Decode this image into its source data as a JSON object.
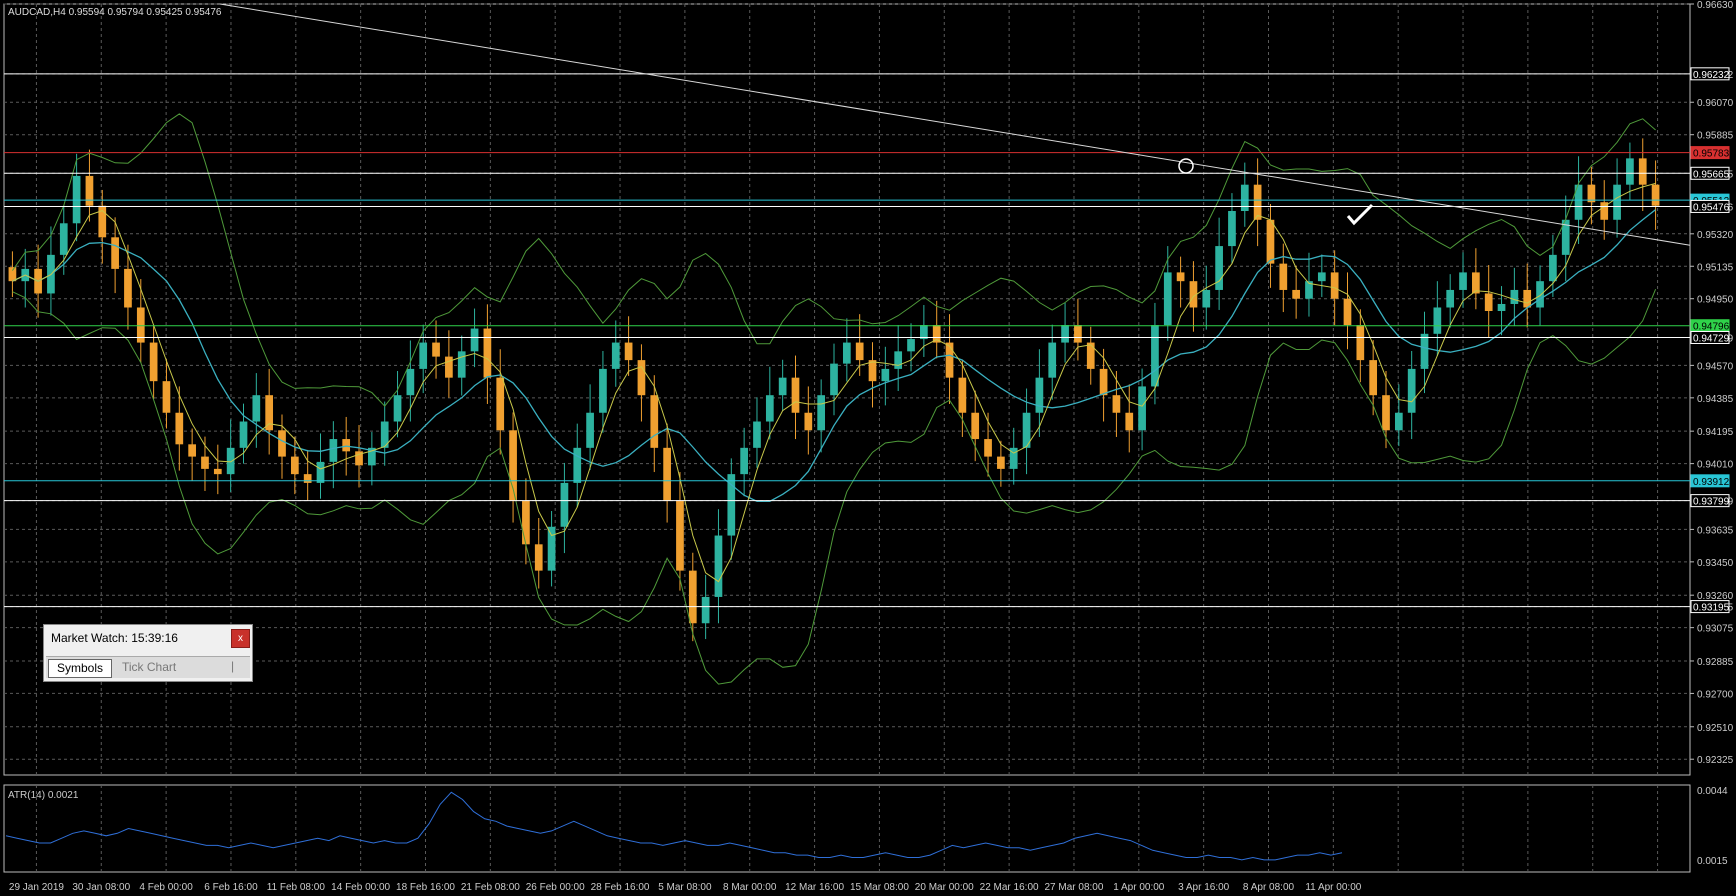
{
  "window": {
    "symbol_line": "AUDCAD,H4  0.95594 0.95794 0.95425 0.95476"
  },
  "colors": {
    "background": "#000000",
    "grid": "#5a5a5a",
    "bull_candle": "#2db3a0",
    "bear_candle": "#f0a030",
    "bollinger": "#4f9a3a",
    "ma_fast": "#c8c84a",
    "ma_slow": "#3ab0c0",
    "atr_line": "#2f6fd8",
    "trendline": "#d8d8d8",
    "support_cyan": "#29c6d6",
    "resistance_red": "#d83030",
    "green_level": "#2fd34a"
  },
  "chart_data": {
    "type": "candlestick",
    "symbol": "AUDCAD",
    "timeframe": "H4",
    "ohlc": {
      "open": 0.95594,
      "high": 0.95794,
      "low": 0.95425,
      "close": 0.95476
    },
    "price_range": [
      0.92235,
      0.9663
    ],
    "price_ticks": [
      "0.96630",
      "0.96232",
      "0.96070",
      "0.95885",
      "0.95665",
      "0.95476",
      "0.95320",
      "0.95135",
      "0.94950",
      "0.94729",
      "0.94570",
      "0.94385",
      "0.94195",
      "0.94010",
      "0.93799",
      "0.93635",
      "0.93450",
      "0.93260",
      "0.93195",
      "0.93075",
      "0.92885",
      "0.92700",
      "0.92510",
      "0.92325"
    ],
    "x_labels": [
      "29 Jan 2019",
      "30 Jan 08:00",
      "4 Feb 00:00",
      "6 Feb 16:00",
      "11 Feb 08:00",
      "14 Feb 00:00",
      "18 Feb 16:00",
      "21 Feb 08:00",
      "26 Feb 00:00",
      "28 Feb 16:00",
      "5 Mar 08:00",
      "8 Mar 00:00",
      "12 Mar 16:00",
      "15 Mar 08:00",
      "20 Mar 00:00",
      "22 Mar 16:00",
      "27 Mar 08:00",
      "1 Apr 00:00",
      "3 Apr 16:00",
      "8 Apr 08:00",
      "11 Apr 00:00"
    ],
    "horizontal_levels": [
      {
        "price": 0.96232,
        "label": "0.96232",
        "color": "#ffffff"
      },
      {
        "price": 0.95783,
        "label": "0.95783",
        "color": "#d83030"
      },
      {
        "price": 0.95665,
        "label": "0.95665",
        "color": "#ffffff"
      },
      {
        "price": 0.95512,
        "label": "0.95512",
        "color": "#29c6d6"
      },
      {
        "price": 0.95476,
        "label": "0.95476",
        "color": "#ffffff"
      },
      {
        "price": 0.94796,
        "label": "0.94796",
        "color": "#2fd34a"
      },
      {
        "price": 0.94729,
        "label": "0.94729",
        "color": "#ffffff"
      },
      {
        "price": 0.93912,
        "label": "0.93912",
        "color": "#29c6d6"
      },
      {
        "price": 0.93799,
        "label": "0.93799",
        "color": "#ffffff"
      },
      {
        "price": 0.93195,
        "label": "0.93195",
        "color": "#ffffff"
      }
    ],
    "close_series": [
      0.9505,
      0.9512,
      0.9498,
      0.952,
      0.9538,
      0.9565,
      0.9548,
      0.953,
      0.9512,
      0.949,
      0.947,
      0.9448,
      0.943,
      0.9412,
      0.9405,
      0.9398,
      0.9395,
      0.941,
      0.9425,
      0.944,
      0.942,
      0.9405,
      0.9395,
      0.939,
      0.9402,
      0.9415,
      0.9408,
      0.94,
      0.941,
      0.9425,
      0.944,
      0.9455,
      0.947,
      0.9462,
      0.945,
      0.9465,
      0.9478,
      0.945,
      0.942,
      0.938,
      0.9355,
      0.934,
      0.9365,
      0.939,
      0.941,
      0.943,
      0.9455,
      0.947,
      0.946,
      0.944,
      0.941,
      0.938,
      0.934,
      0.931,
      0.9325,
      0.936,
      0.9395,
      0.941,
      0.9425,
      0.944,
      0.945,
      0.943,
      0.942,
      0.944,
      0.9458,
      0.947,
      0.946,
      0.9448,
      0.9455,
      0.9465,
      0.9472,
      0.948,
      0.947,
      0.945,
      0.943,
      0.9415,
      0.9405,
      0.9398,
      0.941,
      0.943,
      0.945,
      0.947,
      0.948,
      0.947,
      0.9455,
      0.944,
      0.943,
      0.942,
      0.9445,
      0.948,
      0.951,
      0.9505,
      0.949,
      0.95,
      0.9525,
      0.9545,
      0.956,
      0.954,
      0.9515,
      0.95,
      0.9495,
      0.9505,
      0.951,
      0.9495,
      0.948,
      0.946,
      0.944,
      0.942,
      0.943,
      0.9455,
      0.9475,
      0.949,
      0.95,
      0.951,
      0.9498,
      0.9488,
      0.9492,
      0.95,
      0.949,
      0.9505,
      0.952,
      0.954,
      0.956,
      0.955,
      0.954,
      0.956,
      0.9575,
      0.956,
      0.9548
    ],
    "atr": {
      "label": "ATR(14) 0.0021",
      "ticks": [
        "0.0044",
        "0.0015"
      ],
      "range": [
        0.001,
        0.0046
      ],
      "values": [
        0.0025,
        0.0024,
        0.0023,
        0.0022,
        0.0022,
        0.0024,
        0.0026,
        0.0027,
        0.0026,
        0.0025,
        0.0026,
        0.0028,
        0.0027,
        0.0026,
        0.0025,
        0.0024,
        0.0023,
        0.0022,
        0.0021,
        0.0021,
        0.002,
        0.0021,
        0.0022,
        0.0021,
        0.002,
        0.0021,
        0.0022,
        0.0023,
        0.0024,
        0.0023,
        0.0025,
        0.0024,
        0.0023,
        0.0022,
        0.0023,
        0.0022,
        0.0022,
        0.0024,
        0.003,
        0.0038,
        0.0043,
        0.004,
        0.0035,
        0.0032,
        0.0031,
        0.0029,
        0.0028,
        0.0027,
        0.0026,
        0.0027,
        0.0029,
        0.0031,
        0.0029,
        0.0027,
        0.0025,
        0.0024,
        0.0023,
        0.0022,
        0.0022,
        0.0021,
        0.0022,
        0.0023,
        0.0022,
        0.0021,
        0.0021,
        0.0022,
        0.0021,
        0.002,
        0.0019,
        0.0018,
        0.0018,
        0.0017,
        0.0017,
        0.0016,
        0.0016,
        0.0017,
        0.0016,
        0.0016,
        0.0017,
        0.0018,
        0.0017,
        0.0016,
        0.0016,
        0.0017,
        0.0019,
        0.0021,
        0.002,
        0.0021,
        0.0022,
        0.0021,
        0.002,
        0.002,
        0.0019,
        0.002,
        0.0021,
        0.0022,
        0.0024,
        0.0025,
        0.0026,
        0.0025,
        0.0024,
        0.0023,
        0.0021,
        0.0019,
        0.0018,
        0.0017,
        0.0016,
        0.0016,
        0.0017,
        0.0016,
        0.0016,
        0.0015,
        0.0016,
        0.0015,
        0.0015,
        0.0016,
        0.0017,
        0.0017,
        0.0018,
        0.0017,
        0.0018
      ]
    }
  },
  "market_watch": {
    "title": "Market Watch: 15:39:16",
    "close_label": "x",
    "tabs": [
      {
        "label": "Symbols",
        "active": true
      },
      {
        "label": "Tick Chart",
        "active": false
      }
    ],
    "tab_separator": "|"
  }
}
